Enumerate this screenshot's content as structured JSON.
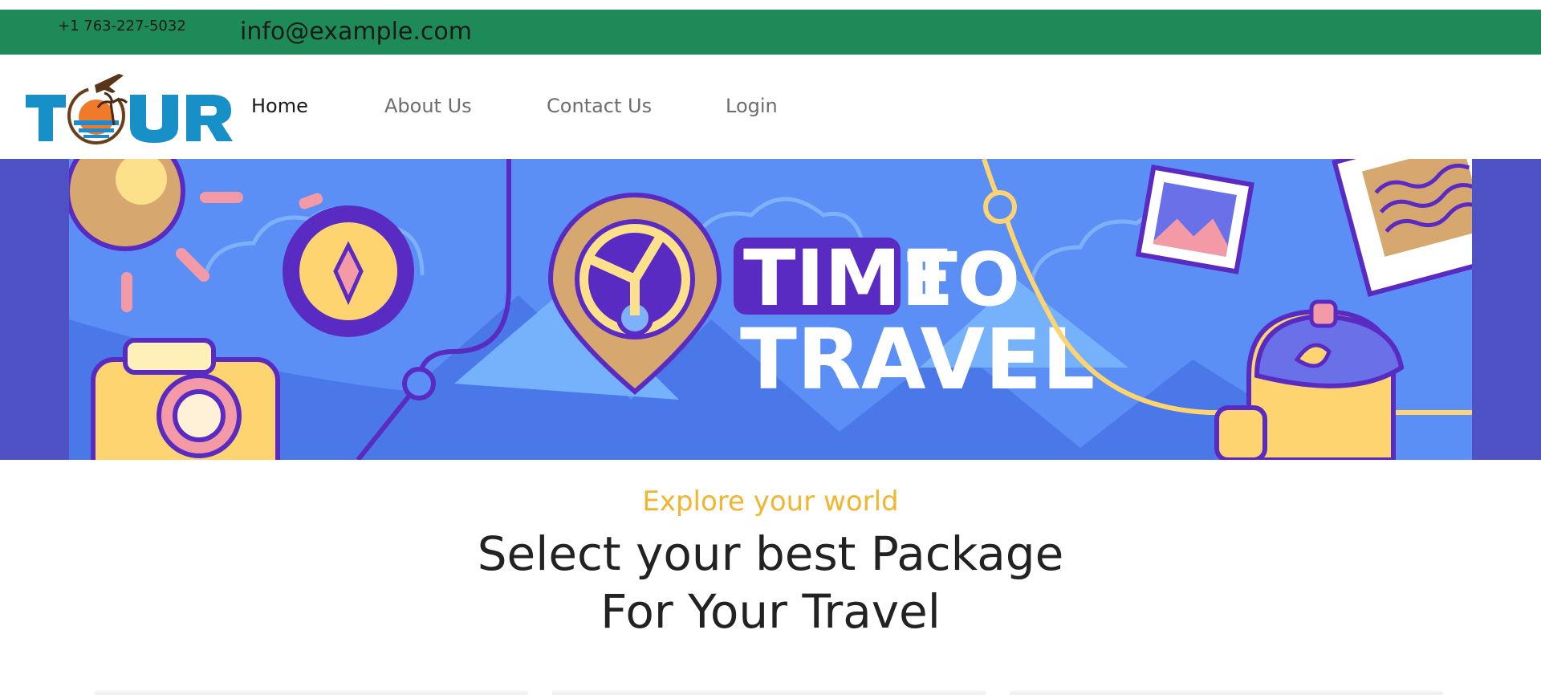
{
  "topbar": {
    "phone": "+1 763-227-5032",
    "email": "info@example.com",
    "background": "#1e8a57"
  },
  "logo": {
    "text": "TOUR",
    "icon": "airplane-sun-palm-icon",
    "color": "#1690c7"
  },
  "nav": {
    "items": [
      {
        "label": "Home",
        "active": true
      },
      {
        "label": "About Us",
        "active": false
      },
      {
        "label": "Contact Us",
        "active": false
      },
      {
        "label": "Login",
        "active": false
      }
    ]
  },
  "banner": {
    "headline_line1_a": "TIME",
    "headline_line1_b": "TO",
    "headline_line2": "TRAVEL",
    "background": "#5b8ff5",
    "accent": "#5a2bc2"
  },
  "hero": {
    "tagline": "Explore your world",
    "title_line1": "Select your best Package",
    "title_line2": "For Your Travel",
    "tagline_color": "#f1b52e"
  }
}
